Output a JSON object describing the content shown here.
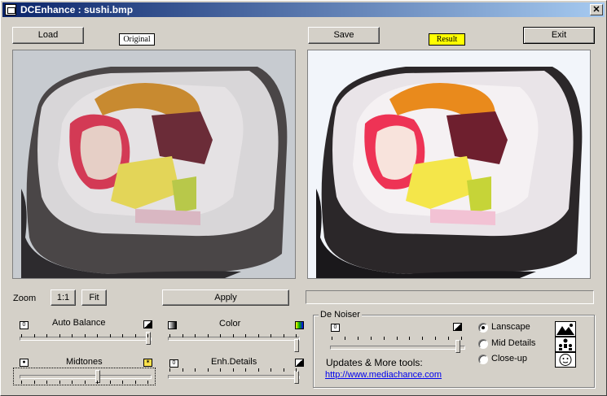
{
  "window": {
    "title": "DCEnhance : sushi.bmp",
    "close_glyph": "✕"
  },
  "toolbar": {
    "load_label": "Load",
    "save_label": "Save",
    "exit_label": "Exit"
  },
  "panes": {
    "original_label": "Original",
    "result_label": "Result",
    "result_label_bg": "#ffff00"
  },
  "zoom": {
    "label": "Zoom",
    "one_to_one_label": "1:1",
    "fit_label": "Fit"
  },
  "apply_label": "Apply",
  "progress": {
    "value": 0
  },
  "sliders": {
    "auto_balance": {
      "label": "Auto Balance",
      "value": 1.0
    },
    "color": {
      "label": "Color",
      "value": 1.0
    },
    "midtones": {
      "label": "Midtones",
      "value": 0.6
    },
    "enh_details": {
      "label": "Enh.Details",
      "value": 1.0
    },
    "denoiser": {
      "value": 1.0
    }
  },
  "denoiser": {
    "group_title": "De Noiser",
    "updates_text": "Updates & More tools:",
    "link_text": "http://www.mediachance.com",
    "options": [
      {
        "label": "Lanscape",
        "selected": true
      },
      {
        "label": "Mid Details",
        "selected": false
      },
      {
        "label": "Close-up",
        "selected": false
      }
    ]
  },
  "icons": {
    "auto_balance_left": "zero-icon",
    "auto_balance_right": "contrast-icon",
    "color_left": "grayscale-icon",
    "color_right": "color-gradient-icon",
    "midtones_left": "dark-point-icon",
    "midtones_right": "sparkle-icon",
    "enh_left": "zero-icon",
    "enh_right": "contrast-icon",
    "mode_landscape": "landscape-icon",
    "mode_people": "people-icon",
    "mode_face": "face-icon"
  }
}
